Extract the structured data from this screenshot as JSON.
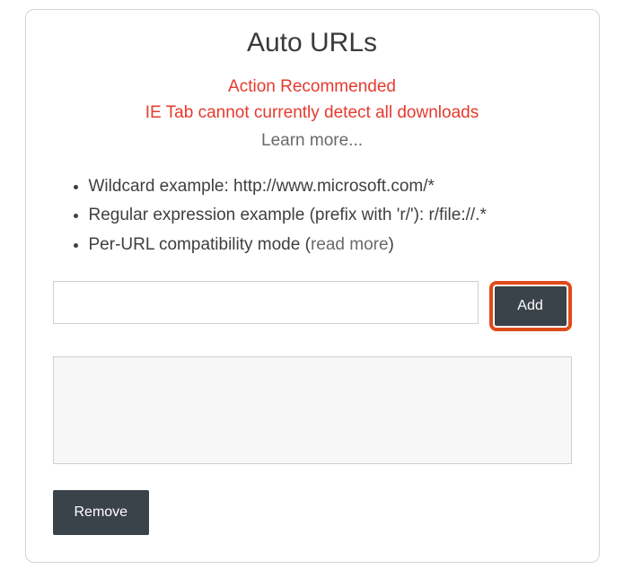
{
  "title": "Auto URLs",
  "alert": {
    "line1": "Action Recommended",
    "line2": "IE Tab cannot currently detect all downloads"
  },
  "learn_more": "Learn more...",
  "examples": {
    "wildcard": "Wildcard example: http://www.microsoft.com/*",
    "regex": "Regular expression example (prefix with 'r/'): r/file://.*",
    "perurl_prefix": "Per-URL compatibility mode (",
    "perurl_link": "read more",
    "perurl_suffix": ")"
  },
  "input": {
    "value": "",
    "placeholder": ""
  },
  "buttons": {
    "add": "Add",
    "remove": "Remove"
  },
  "list": {
    "value": ""
  }
}
